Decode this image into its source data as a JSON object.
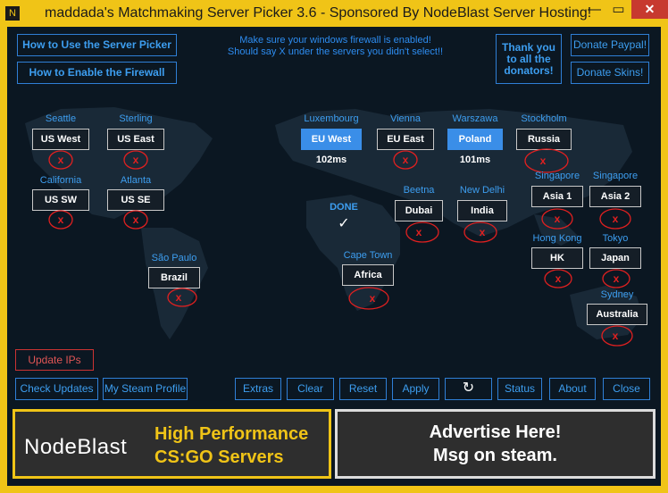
{
  "window": {
    "title": "maddada's Matchmaking Server Picker 3.6 - Sponsored By NodeBlast Server Hosting!",
    "minimize_glyph": "—",
    "maximize_glyph": "▭",
    "close_glyph": "✕",
    "app_icon": "N"
  },
  "top": {
    "how_to_use": "How to Use the Server Picker",
    "enable_firewall": "How to Enable the Firewall",
    "message_line1": "Make sure your windows firewall is enabled!",
    "message_line2": "Should say X under the servers you didn't select!!",
    "thanks_line1": "Thank you",
    "thanks_line2": "to all the",
    "thanks_line3": "donators!",
    "donate_paypal": "Donate Paypal!",
    "donate_skins": "Donate Skins!"
  },
  "servers": [
    {
      "id": "us-west",
      "city": "Seattle",
      "label": "US West",
      "selected": false,
      "ping": "",
      "blocked": true
    },
    {
      "id": "us-east",
      "city": "Sterling",
      "label": "US East",
      "selected": false,
      "ping": "",
      "blocked": true
    },
    {
      "id": "us-sw",
      "city": "California",
      "label": "US SW",
      "selected": false,
      "ping": "",
      "blocked": true
    },
    {
      "id": "us-se",
      "city": "Atlanta",
      "label": "US SE",
      "selected": false,
      "ping": "",
      "blocked": true
    },
    {
      "id": "brazil",
      "city": "São Paulo",
      "label": "Brazil",
      "selected": false,
      "ping": "",
      "blocked": true
    },
    {
      "id": "eu-west",
      "city": "Luxembourg",
      "label": "EU West",
      "selected": true,
      "ping": "102ms",
      "blocked": false
    },
    {
      "id": "eu-east",
      "city": "Vienna",
      "label": "EU East",
      "selected": false,
      "ping": "",
      "blocked": true
    },
    {
      "id": "poland",
      "city": "Warszawa",
      "label": "Poland",
      "selected": true,
      "ping": "101ms",
      "blocked": false
    },
    {
      "id": "russia",
      "city": "Stockholm",
      "label": "Russia",
      "selected": false,
      "ping": "",
      "blocked": true
    },
    {
      "id": "dubai",
      "city": "Beetna",
      "label": "Dubai",
      "selected": false,
      "ping": "",
      "blocked": true
    },
    {
      "id": "india",
      "city": "New Delhi",
      "label": "India",
      "selected": false,
      "ping": "",
      "blocked": true
    },
    {
      "id": "africa",
      "city": "Cape Town",
      "label": "Africa",
      "selected": false,
      "ping": "",
      "blocked": true
    },
    {
      "id": "asia-1",
      "city": "Singapore",
      "label": "Asia 1",
      "selected": false,
      "ping": "",
      "blocked": true
    },
    {
      "id": "asia-2",
      "city": "Singapore",
      "label": "Asia 2",
      "selected": false,
      "ping": "",
      "blocked": true
    },
    {
      "id": "hk",
      "city": "Hong Kong",
      "label": "HK",
      "selected": false,
      "ping": "",
      "blocked": true
    },
    {
      "id": "japan",
      "city": "Tokyo",
      "label": "Japan",
      "selected": false,
      "ping": "",
      "blocked": true
    },
    {
      "id": "australia",
      "city": "Sydney",
      "label": "Australia",
      "selected": false,
      "ping": "",
      "blocked": true
    }
  ],
  "status": {
    "done_label": "DONE",
    "done_mark": "✓"
  },
  "bottom": {
    "update_ips": "Update IPs",
    "check_updates": "Check Updates",
    "my_steam_profile": "My Steam Profile",
    "extras": "Extras",
    "clear": "Clear",
    "reset": "Reset",
    "apply": "Apply",
    "refresh_glyph": "↻",
    "status": "Status",
    "about": "About",
    "close": "Close"
  },
  "ads": {
    "nodeblast_logo": "NodeBlast",
    "nodeblast_line1": "High Performance",
    "nodeblast_line2": "CS:GO Servers",
    "advertise_line1": "Advertise Here!",
    "advertise_line2": "Msg on steam."
  },
  "colors": {
    "accent": "#3d9ef0",
    "frame": "#f0c417",
    "background": "#0b1722",
    "selected": "#3a8ee8",
    "blocked_mark": "#e02020"
  }
}
